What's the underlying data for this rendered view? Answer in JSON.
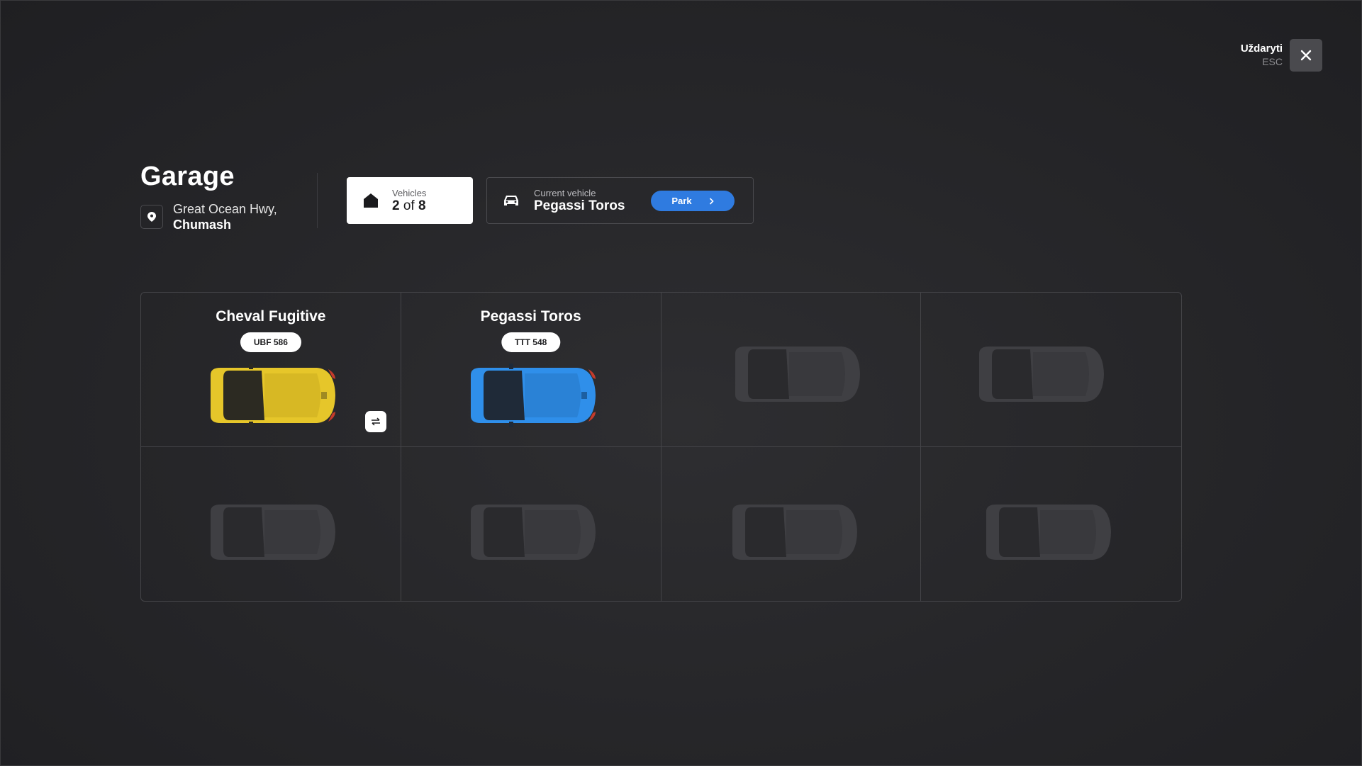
{
  "close": {
    "label": "Uždaryti",
    "hint": "ESC",
    "icon": "close-icon"
  },
  "header": {
    "title": "Garage",
    "location": {
      "street": "Great Ocean Hwy,",
      "area": "Chumash",
      "icon": "map-pin-icon"
    }
  },
  "vehicles_card": {
    "label": "Vehicles",
    "count": "2",
    "of": "of",
    "total": "8",
    "icon": "garage-icon"
  },
  "current_vehicle": {
    "label": "Current vehicle",
    "name": "Pegassi Toros",
    "icon": "car-icon",
    "park_button": "Park"
  },
  "colors": {
    "accent": "#2f7be0",
    "car_yellow": "#e6c62a",
    "car_blue": "#2f8fea",
    "empty_car": "#3f3f43"
  },
  "slots": [
    {
      "name": "Cheval Fugitive",
      "plate": "UBF 586",
      "color": "yellow",
      "occupied": true,
      "swap_icon": "swap-icon"
    },
    {
      "name": "Pegassi Toros",
      "plate": "TTT 548",
      "color": "blue",
      "occupied": true
    },
    {
      "occupied": false
    },
    {
      "occupied": false
    },
    {
      "occupied": false
    },
    {
      "occupied": false
    },
    {
      "occupied": false
    },
    {
      "occupied": false
    }
  ]
}
